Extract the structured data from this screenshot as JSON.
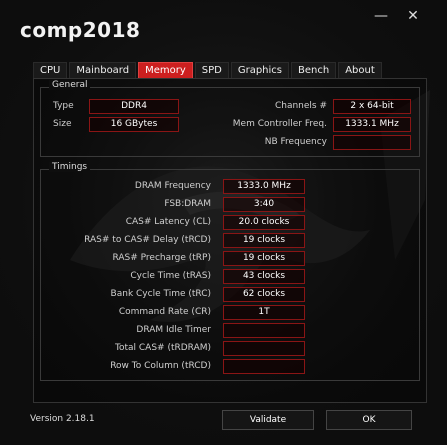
{
  "window": {
    "title": "comp2018",
    "controls": {
      "minimize": "—",
      "close": "✕"
    }
  },
  "tabs": [
    {
      "label": "CPU"
    },
    {
      "label": "Mainboard"
    },
    {
      "label": "Memory"
    },
    {
      "label": "SPD"
    },
    {
      "label": "Graphics"
    },
    {
      "label": "Bench"
    },
    {
      "label": "About"
    }
  ],
  "general": {
    "legend": "General",
    "type_label": "Type",
    "type_value": "DDR4",
    "size_label": "Size",
    "size_value": "16 GBytes",
    "channels_label": "Channels #",
    "channels_value": "2 x 64-bit",
    "mem_ctrl_label": "Mem Controller Freq.",
    "mem_ctrl_value": "1333.1 MHz",
    "nb_freq_label": "NB Frequency",
    "nb_freq_value": ""
  },
  "timings": {
    "legend": "Timings",
    "rows": [
      {
        "label": "DRAM Frequency",
        "value": "1333.0 MHz"
      },
      {
        "label": "FSB:DRAM",
        "value": "3:40"
      },
      {
        "label": "CAS# Latency (CL)",
        "value": "20.0 clocks"
      },
      {
        "label": "RAS# to CAS# Delay (tRCD)",
        "value": "19 clocks"
      },
      {
        "label": "RAS# Precharge (tRP)",
        "value": "19 clocks"
      },
      {
        "label": "Cycle Time (tRAS)",
        "value": "43 clocks"
      },
      {
        "label": "Bank Cycle Time (tRC)",
        "value": "62 clocks"
      },
      {
        "label": "Command Rate (CR)",
        "value": "1T"
      },
      {
        "label": "DRAM Idle Timer",
        "value": ""
      },
      {
        "label": "Total CAS# (tRDRAM)",
        "value": ""
      },
      {
        "label": "Row To Column (tRCD)",
        "value": ""
      }
    ]
  },
  "footer": {
    "version": "Version 2.18.1",
    "validate": "Validate",
    "ok": "OK"
  },
  "colors": {
    "accent": "#cc1f1f",
    "border_value": "#8a1515"
  }
}
